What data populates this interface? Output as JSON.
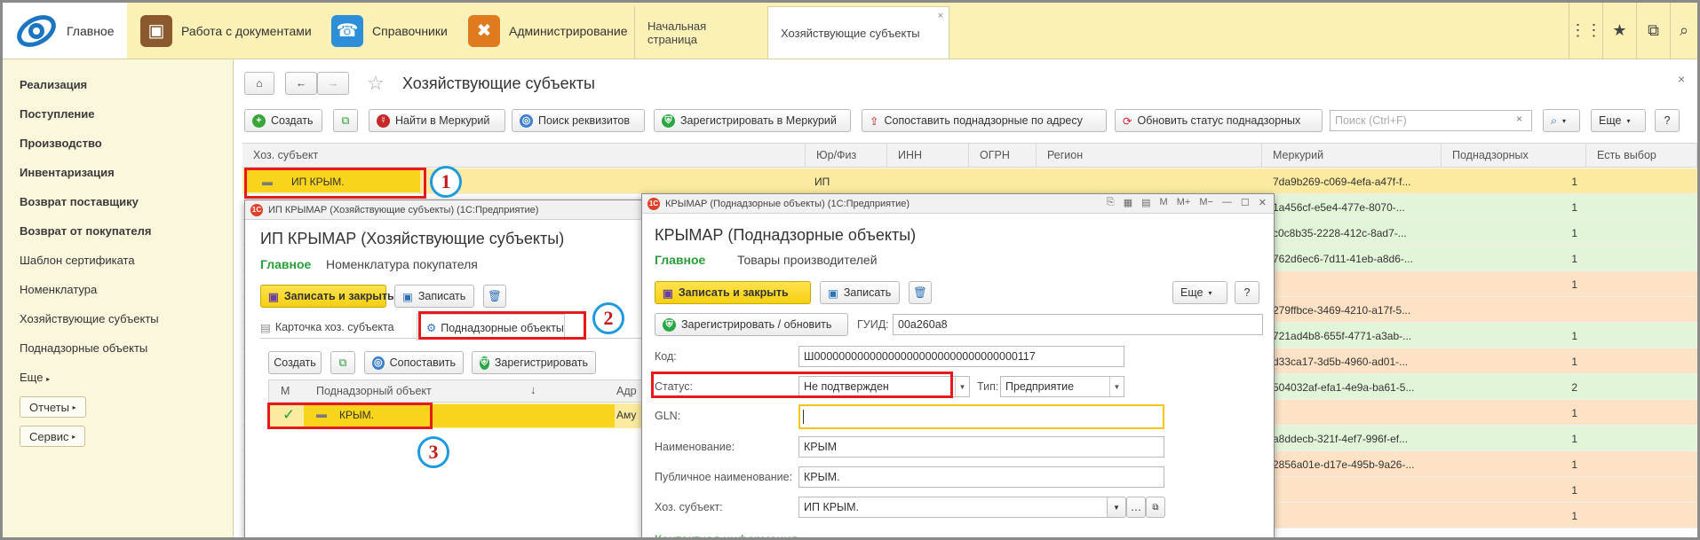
{
  "topbar": {
    "home": "Главное",
    "sections": [
      "Работа с документами",
      "Справочники",
      "Администрирование"
    ],
    "tabs": [
      "Начальная страница",
      "Хозяйствующие субъекты"
    ],
    "tab_close": "×"
  },
  "sidebar": {
    "bold_items": [
      "Реализация",
      "Поступление",
      "Производство",
      "Инвентаризация",
      "Возврат поставщику",
      "Возврат от покупателя"
    ],
    "items": [
      "Шаблон сертификата",
      "Номенклатура",
      "Хозяйствующие субъекты",
      "Поднадзорные объекты",
      "Еще"
    ],
    "buttons": [
      "Отчеты",
      "Сервис"
    ]
  },
  "main": {
    "title": "Хозяйствующие субъекты",
    "close": "×",
    "toolbar": {
      "create": "Создать",
      "find_mercury": "Найти в Меркурий",
      "search_req": "Поиск реквизитов",
      "register_mercury": "Зарегистрировать в Меркурий",
      "match_address": "Сопоставить поднадзорные по адресу",
      "update_status": "Обновить статус поднадзорных",
      "search_placeholder": "Поиск (Ctrl+F)",
      "more": "Еще",
      "help": "?"
    },
    "columns": [
      "Хоз. субъект",
      "Юр/Физ",
      "ИНН",
      "ОГРН",
      "Регион",
      "Меркурий",
      "Поднадзорных",
      "Есть выбор"
    ],
    "first_row": {
      "name": "ИП КРЫМ.",
      "type": "ИП",
      "mercury": "7da9b269-c069-4efa-a47f-f...",
      "count": "1"
    },
    "rows": [
      {
        "mercury": "1a456cf-e5e4-477e-8070-...",
        "count": "1",
        "color": "#e3f5d8"
      },
      {
        "mercury": "c0c8b35-2228-412c-8ad7-...",
        "count": "1",
        "color": "#e3f5d8"
      },
      {
        "mercury": "762d6ec6-7d11-41eb-a8d6-...",
        "count": "1",
        "color": "#e3f5d8"
      },
      {
        "mercury": "",
        "count": "1",
        "color": "#fde2c6"
      },
      {
        "mercury": "279ffbce-3469-4210-a17f-5...",
        "count": "",
        "color": "#fde2c6"
      },
      {
        "mercury": "721ad4b8-655f-4771-a3ab-...",
        "count": "1",
        "color": "#e3f5d8"
      },
      {
        "mercury": "d33ca17-3d5b-4960-ad01-...",
        "count": "1",
        "color": "#fde2c6"
      },
      {
        "mercury": "504032af-efa1-4e9a-ba61-5...",
        "count": "2",
        "color": "#e3f5d8"
      },
      {
        "mercury": "",
        "count": "1",
        "color": "#fde2c6"
      },
      {
        "mercury": "a8ddecb-321f-4ef7-996f-ef...",
        "count": "1",
        "color": "#e3f5d8"
      },
      {
        "mercury": "2856a01e-d17e-495b-9a26-...",
        "count": "1",
        "color": "#fde2c6"
      },
      {
        "mercury": "",
        "count": "1",
        "color": "#fde2c6"
      },
      {
        "mercury": "",
        "count": "1",
        "color": "#fde2c6"
      }
    ]
  },
  "win1": {
    "titlebar": "ИП КРЫМАР (Хозяйствующие субъекты)  (1С:Предприятие)",
    "heading": "ИП КРЫМАР (Хозяйствующие субъекты)",
    "nav_main": "Главное",
    "nav_other": "Номенклатура покупателя",
    "save_close": "Записать и закрыть",
    "save": "Записать",
    "tab_card": "Карточка хоз. субъекта",
    "tab_objects": "Поднадзорные объекты",
    "create": "Создать",
    "match": "Сопоставить",
    "register": "Зарегистрировать",
    "col_m": "М",
    "col_object": "Поднадзорный объект",
    "col_addr": "Адр",
    "row_name": "КРЫМ.",
    "row_addr": "Аму"
  },
  "win2": {
    "titlebar": "КРЫМАР (Поднадзорные объекты)  (1С:Предприятие)",
    "heading": "КРЫМАР (Поднадзорные объекты)",
    "nav_main": "Главное",
    "nav_other": "Товары производителей",
    "save_close": "Записать и закрыть",
    "save": "Записать",
    "more": "Еще",
    "help": "?",
    "register_update": "Зарегистрировать / обновить",
    "guid_label": "ГУИД:",
    "guid_value": "00a260a8",
    "code_label": "Код:",
    "code_value": "Ш000000000000000000000000000000000117",
    "status_label": "Статус:",
    "status_value": "Не подтвержден",
    "type_label": "Тип:",
    "type_value": "Предприятие",
    "gln_label": "GLN:",
    "gln_value": "",
    "name_label": "Наименование:",
    "name_value": "КРЫМ",
    "public_label": "Публичное наименование:",
    "public_value": "КРЫМ.",
    "subject_label": "Хоз. субъект:",
    "subject_value": "ИП КРЫМ.",
    "contact": "Контактная информация"
  },
  "badges": [
    "1",
    "2",
    "3"
  ]
}
